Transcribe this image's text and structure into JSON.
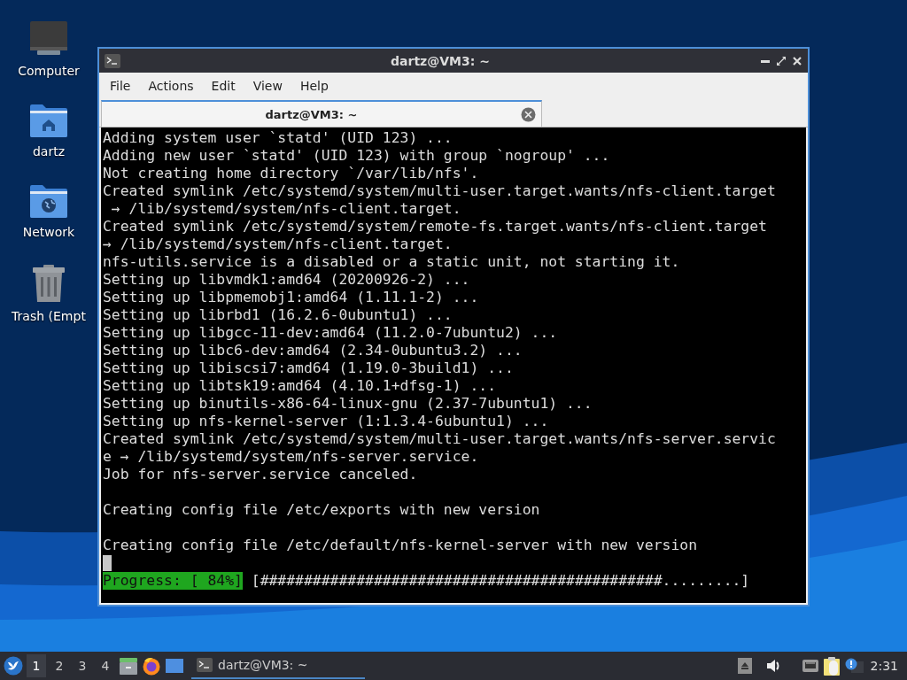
{
  "desktop_icons": [
    {
      "label": "Computer",
      "kind": "computer"
    },
    {
      "label": "dartz",
      "kind": "home"
    },
    {
      "label": "Network",
      "kind": "network"
    },
    {
      "label": "Trash (Empt",
      "kind": "trash"
    }
  ],
  "window": {
    "title": "dartz@VM3: ~",
    "menu": [
      "File",
      "Actions",
      "Edit",
      "View",
      "Help"
    ],
    "tabs": [
      {
        "label": "dartz@VM3: ~",
        "selected": true
      }
    ],
    "terminal_lines": [
      {
        "kind": "text",
        "text": "Adding system user `statd' (UID 123) ..."
      },
      {
        "kind": "text",
        "text": "Adding new user `statd' (UID 123) with group `nogroup' ..."
      },
      {
        "kind": "text",
        "text": "Not creating home directory `/var/lib/nfs'."
      },
      {
        "kind": "text",
        "text": "Created symlink /etc/systemd/system/multi-user.target.wants/nfs-client.target"
      },
      {
        "kind": "text",
        "text": " → /lib/systemd/system/nfs-client.target."
      },
      {
        "kind": "text",
        "text": "Created symlink /etc/systemd/system/remote-fs.target.wants/nfs-client.target"
      },
      {
        "kind": "text",
        "text": "→ /lib/systemd/system/nfs-client.target."
      },
      {
        "kind": "text",
        "text": "nfs-utils.service is a disabled or a static unit, not starting it."
      },
      {
        "kind": "text",
        "text": "Setting up libvmdk1:amd64 (20200926-2) ..."
      },
      {
        "kind": "text",
        "text": "Setting up libpmemobj1:amd64 (1.11.1-2) ..."
      },
      {
        "kind": "text",
        "text": "Setting up librbd1 (16.2.6-0ubuntu1) ..."
      },
      {
        "kind": "text",
        "text": "Setting up libgcc-11-dev:amd64 (11.2.0-7ubuntu2) ..."
      },
      {
        "kind": "text",
        "text": "Setting up libc6-dev:amd64 (2.34-0ubuntu3.2) ..."
      },
      {
        "kind": "text",
        "text": "Setting up libiscsi7:amd64 (1.19.0-3build1) ..."
      },
      {
        "kind": "text",
        "text": "Setting up libtsk19:amd64 (4.10.1+dfsg-1) ..."
      },
      {
        "kind": "text",
        "text": "Setting up binutils-x86-64-linux-gnu (2.37-7ubuntu1) ..."
      },
      {
        "kind": "text",
        "text": "Setting up nfs-kernel-server (1:1.3.4-6ubuntu1) ..."
      },
      {
        "kind": "text",
        "text": "Created symlink /etc/systemd/system/multi-user.target.wants/nfs-server.servic"
      },
      {
        "kind": "text",
        "text": "e → /lib/systemd/system/nfs-server.service."
      },
      {
        "kind": "text",
        "text": "Job for nfs-server.service canceled."
      },
      {
        "kind": "blank"
      },
      {
        "kind": "text",
        "text": "Creating config file /etc/exports with new version"
      },
      {
        "kind": "blank"
      },
      {
        "kind": "text",
        "text": "Creating config file /etc/default/nfs-kernel-server with new version"
      },
      {
        "kind": "cursor"
      },
      {
        "kind": "progress",
        "label": "Progress: [ 84%]",
        "bar": "[##############################################.........]"
      }
    ]
  },
  "taskbar": {
    "workspaces": [
      {
        "label": "1",
        "selected": true
      },
      {
        "label": "2",
        "selected": false
      },
      {
        "label": "3",
        "selected": false
      },
      {
        "label": "4",
        "selected": false
      }
    ],
    "tasks": [
      {
        "label": "dartz@VM3: ~",
        "selected": true
      }
    ],
    "clock": "2:31"
  }
}
